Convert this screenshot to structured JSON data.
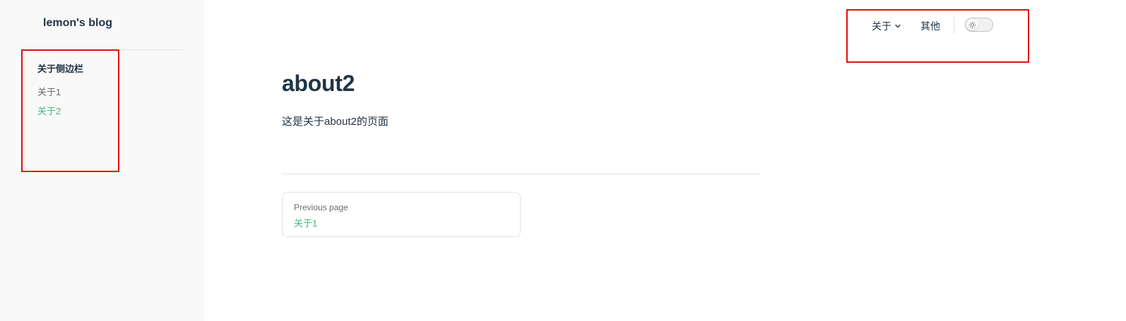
{
  "site": {
    "title": "lemon's blog"
  },
  "sidebar": {
    "group_title": "关于侧边栏",
    "items": [
      {
        "label": "关于1",
        "active": false
      },
      {
        "label": "关于2",
        "active": true
      }
    ]
  },
  "nav": {
    "items": [
      {
        "label": "关于",
        "has_dropdown": true
      },
      {
        "label": "其他",
        "has_dropdown": false
      }
    ],
    "appearance_toggle": {
      "icon": "sun-icon",
      "state": "light"
    }
  },
  "main": {
    "title": "about2",
    "text": "这是关于about2的页面",
    "prev": {
      "desc": "Previous page",
      "title": "关于1"
    }
  },
  "colors": {
    "brand": "#42b883",
    "text": "#213547",
    "muted": "#6b6b6b",
    "sidebar_bg": "#f9f9f9",
    "highlight_box": "#e10f0f",
    "divider": "#e2e2e3"
  }
}
